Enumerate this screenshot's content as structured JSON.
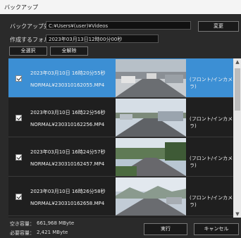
{
  "window": {
    "title": "バックアップ"
  },
  "backup_dest": {
    "label": "バックアップ先：",
    "value": "C:¥Users¥(user)¥Videos",
    "change_button": "変更"
  },
  "folder": {
    "label": "作成するフォルダ：",
    "value": "2023年03月13日12時00分00秒"
  },
  "select_all": "全選択",
  "deselect_all": "全解除",
  "items": [
    {
      "datetime": "2023年03月10日 16時20分55秒",
      "filename": "NORMAL¥230310162055.MP4",
      "camera": "(フロント/インカメラ)",
      "checked": true,
      "selected": true
    },
    {
      "datetime": "2023年03月10日 16時22分56秒",
      "filename": "NORMAL¥230310162256.MP4",
      "camera": "(フロント/インカメラ)",
      "checked": true,
      "selected": false
    },
    {
      "datetime": "2023年03月10日 16時24分57秒",
      "filename": "NORMAL¥230310162457.MP4",
      "camera": "(フロント/インカメラ)",
      "checked": true,
      "selected": false
    },
    {
      "datetime": "2023年03月10日 16時26分58秒",
      "filename": "NORMAL¥230310162658.MP4",
      "camera": "(フロント/インカメラ)",
      "checked": true,
      "selected": false
    }
  ],
  "footer": {
    "free_label": "空き容量：",
    "free_value": "661,968 MByte",
    "need_label": "必要容量：",
    "need_value": "2,421 MByte",
    "run_button": "実行",
    "cancel_button": "キャンセル"
  }
}
